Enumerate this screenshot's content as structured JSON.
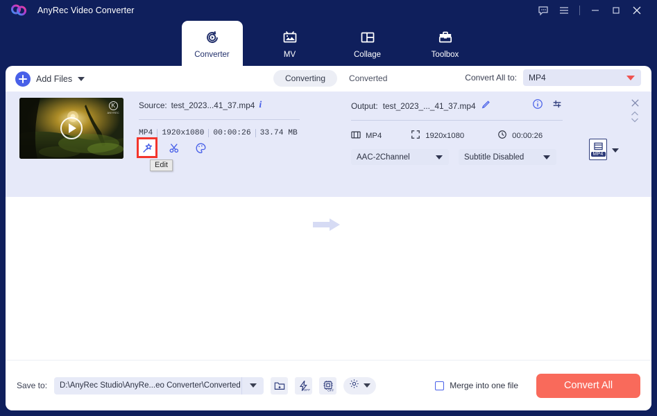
{
  "window": {
    "app_title": "AnyRec Video Converter",
    "logo_icon": "anyrec-logo-icon",
    "controls": [
      {
        "name": "feedback-icon",
        "glyph": "speech-bubble"
      },
      {
        "name": "menu-icon",
        "glyph": "hamburger"
      },
      {
        "name": "minimize-icon",
        "glyph": "minimize"
      },
      {
        "name": "maximize-icon",
        "glyph": "maximize"
      },
      {
        "name": "close-icon",
        "glyph": "close"
      }
    ]
  },
  "nav": {
    "tabs": [
      {
        "label": "Converter",
        "icon": "converter-icon",
        "active": true
      },
      {
        "label": "MV",
        "icon": "mv-icon",
        "active": false
      },
      {
        "label": "Collage",
        "icon": "collage-icon",
        "active": false
      },
      {
        "label": "Toolbox",
        "icon": "toolbox-icon",
        "active": false
      }
    ]
  },
  "toolbar": {
    "add_files_label": "Add Files",
    "add_files_icon": "plus-circle-icon",
    "tab_converting": "Converting",
    "tab_converted": "Converted",
    "convert_all_to_label": "Convert All to:",
    "convert_all_to_value": "MP4"
  },
  "file_row": {
    "thumbnail": {
      "name": "video-thumbnail",
      "play_icon": "play-icon",
      "watermark_text": "ANYREC"
    },
    "source": {
      "prefix": "Source:",
      "filename": "test_2023...41_37.mp4",
      "info_icon": "info-icon",
      "format": "MP4",
      "resolution": "1920x1080",
      "duration": "00:00:26",
      "filesize": "33.74 MB"
    },
    "edit_tools": [
      {
        "name": "edit-magic-wand-icon",
        "tooltip": "Edit",
        "selected": true
      },
      {
        "name": "trim-scissors-icon",
        "tooltip": "Trim",
        "selected": false
      },
      {
        "name": "effect-palette-icon",
        "tooltip": "Effect",
        "selected": false
      }
    ],
    "tooltip_text": "Edit",
    "arrow_icon": "right-arrow-icon",
    "output": {
      "prefix": "Output:",
      "filename": "test_2023_..._41_37.mp4",
      "edit_pencil_icon": "pencil-icon",
      "info_icon": "info-circle-icon",
      "settings_icon": "sliders-icon",
      "format": "MP4",
      "format_icon": "film-icon",
      "resolution": "1920x1080",
      "resolution_icon": "expand-icon",
      "duration": "00:00:26",
      "duration_icon": "clock-icon",
      "audio_track": "AAC-2Channel",
      "subtitle": "Subtitle Disabled"
    },
    "format_badge": "MP4",
    "format_badge_icon": "mp4-file-icon",
    "close_icon": "remove-file-icon",
    "reorder_icon": "reorder-updown-icon"
  },
  "bottom": {
    "save_to_label": "Save to:",
    "save_to_path": "D:\\AnyRec Studio\\AnyRe...eo Converter\\Converted",
    "folder_icon": "open-folder-icon",
    "hw_accel_icon": "hardware-accel-off-icon",
    "gpu_icon": "gpu-off-icon",
    "settings_gear_icon": "gear-icon",
    "merge_label": "Merge into one file",
    "merge_checked": false,
    "convert_all_label": "Convert All"
  },
  "colors": {
    "window_bg": "#0f1f5c",
    "panel_bg": "#ffffff",
    "row_bg": "#e6e9f9",
    "accent_blue": "#4860e8",
    "accent_red": "#f96a5b",
    "highlight_box": "#f3352c",
    "dropdown_bg": "#e3e6f6"
  }
}
